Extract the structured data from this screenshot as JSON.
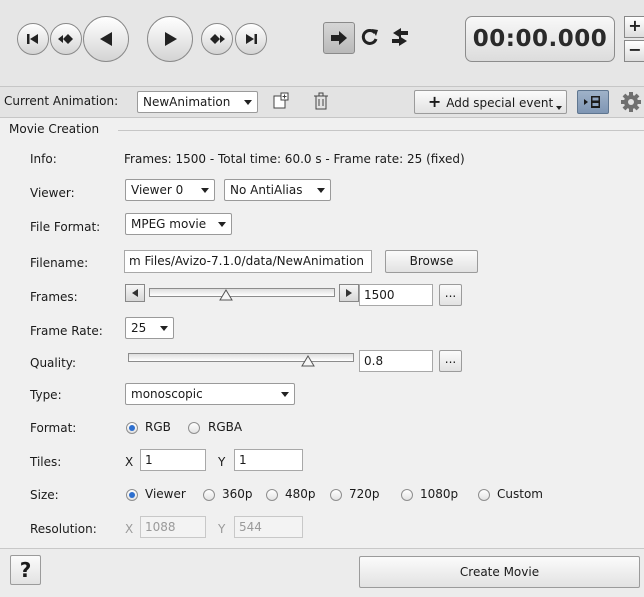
{
  "transport": {
    "buttons": [
      "go-to-start",
      "previous-keyframe",
      "step-backward",
      "play-forward",
      "next-keyframe",
      "go-to-end"
    ],
    "time": "00:00.000",
    "plus": "+",
    "minus": "−"
  },
  "animbar": {
    "current_label": "Current Animation:",
    "current_value": "NewAnimation",
    "add_event": "Add special event",
    "add_event_plus": "+"
  },
  "movie": {
    "group_title": "Movie Creation",
    "info_label": "Info:",
    "info_value": "Frames: 1500 - Total time: 60.0 s - Frame rate: 25 (fixed)",
    "viewer_label": "Viewer:",
    "viewer_value": "Viewer 0",
    "antialias_value": "No AntiAlias",
    "file_format_label": "File Format:",
    "file_format_value": "MPEG movie",
    "filename_label": "Filename:",
    "filename_value": "m Files/Avizo-7.1.0/data/NewAnimation",
    "browse": "Browse",
    "frames_label": "Frames:",
    "frames_value": "1500",
    "frames_slider_level": 0.41,
    "ellipsis": "...",
    "frame_rate_label": "Frame Rate:",
    "frame_rate_value": "25",
    "quality_label": "Quality:",
    "quality_value": "0.8",
    "quality_slider_level": 0.8,
    "type_label": "Type:",
    "type_value": "monoscopic",
    "format_label": "Format:",
    "format_options": [
      "RGB",
      "RGBA"
    ],
    "format_selected": "RGB",
    "tiles_label": "Tiles:",
    "tiles_x_label": "X",
    "tiles_x_value": "1",
    "tiles_y_label": "Y",
    "tiles_y_value": "1",
    "size_label": "Size:",
    "size_options": [
      "Viewer",
      "360p",
      "480p",
      "720p",
      "1080p",
      "Custom"
    ],
    "size_selected": "Viewer",
    "resolution_label": "Resolution:",
    "resolution_x_label": "X",
    "resolution_x_value": "1088",
    "resolution_y_label": "Y",
    "resolution_y_value": "544"
  },
  "bottom": {
    "help": "?",
    "create_movie": "Create Movie"
  }
}
